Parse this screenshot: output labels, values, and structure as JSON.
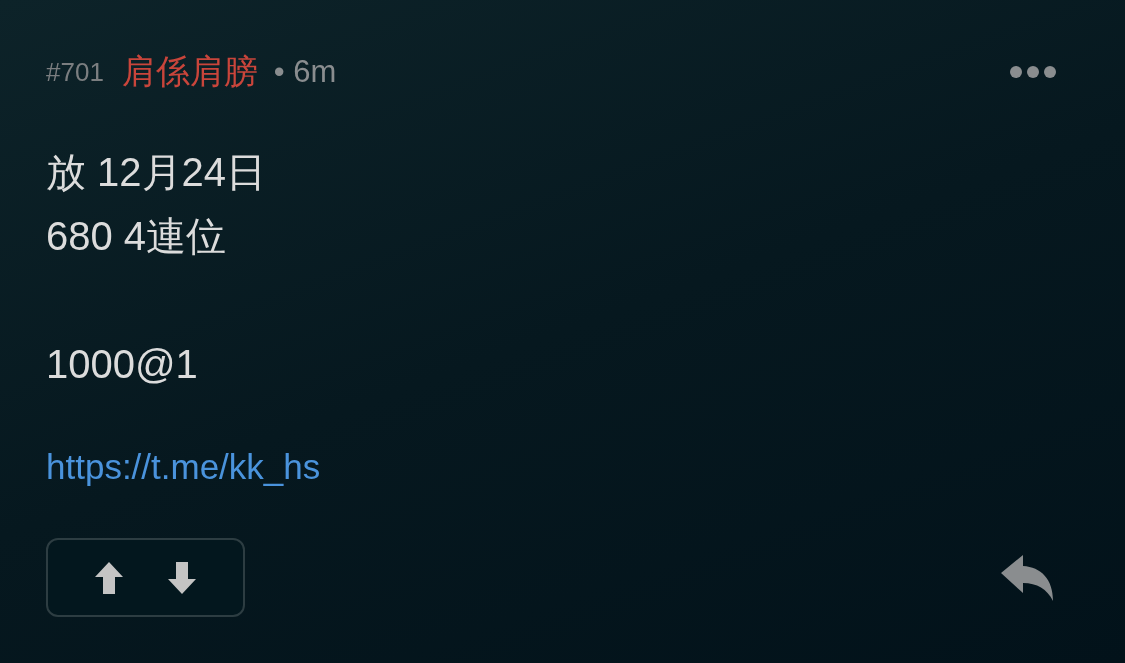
{
  "post": {
    "number": "#701",
    "author": "肩係肩膀",
    "time": "• 6m",
    "paragraphs": [
      [
        "放 12月24日",
        "680 4連位"
      ],
      [
        "1000@1"
      ]
    ],
    "link": "https://t.me/kk_hs"
  }
}
